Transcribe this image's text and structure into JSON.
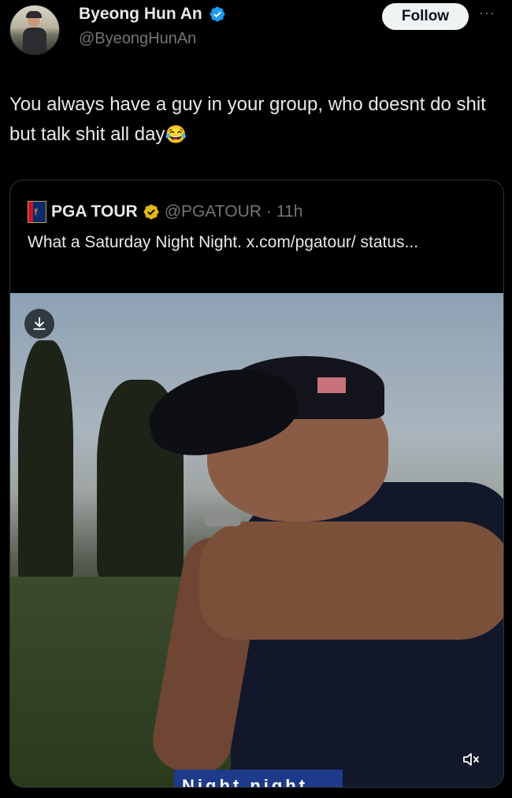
{
  "author": {
    "display_name": "Byeong Hun An",
    "handle": "@ByeongHunAn",
    "verified": true,
    "verified_color": "#1d9bf0"
  },
  "actions": {
    "follow_label": "Follow",
    "more_label": "···"
  },
  "tweet": {
    "text": "You always have a guy in your group, who doesnt do shit but talk shit all day",
    "emoji": "😂"
  },
  "quoted_tweet": {
    "display_name": "PGA TOUR",
    "handle": "@PGATOUR",
    "separator": "·",
    "time": "11h",
    "verified_color": "#e2b719",
    "text": "What a Saturday Night Night. x.com/pgatour/ status...",
    "media": {
      "caption_text": "Night night",
      "download_icon": "download-icon",
      "mute_icon": "speaker-muted-icon"
    }
  },
  "colors": {
    "background": "#000000",
    "text_primary": "#e7e9ea",
    "text_secondary": "#71767b",
    "border": "#2f3336"
  }
}
